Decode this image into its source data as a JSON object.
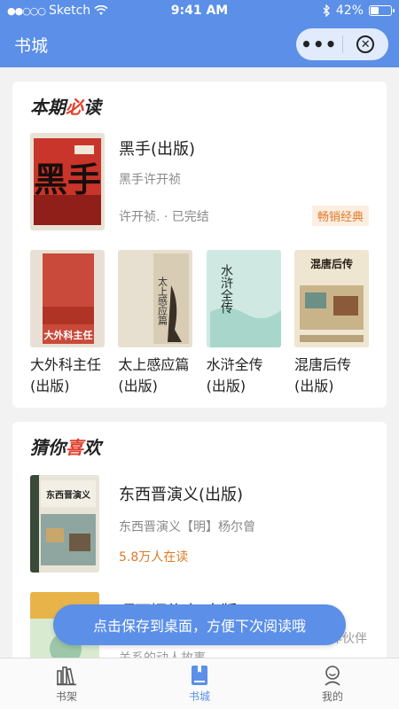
{
  "status_bar": {
    "carrier": "Sketch",
    "time": "9:41 AM",
    "battery_percent": "42%",
    "battery_level": 0.42,
    "signal_dots": "●●○○○"
  },
  "navbar": {
    "title": "书城",
    "more_label": "•••"
  },
  "must_read": {
    "title_before": "本期",
    "title_accent": "必",
    "title_after": "读",
    "featured": {
      "title": "黑手(出版)",
      "subtitle": "黑手许开祯",
      "author_status": "许开祯. · 已完结",
      "tag": "畅销经典",
      "cover_text": "黑手"
    },
    "books": [
      {
        "title_line1": "大外科主任",
        "title_line2": "(出版)",
        "cover_text": "大外科主任"
      },
      {
        "title_line1": "太上感应篇",
        "title_line2": "(出版)",
        "cover_text": "太上感应篇"
      },
      {
        "title_line1": "水浒全传",
        "title_line2": "(出版)",
        "cover_text": "水浒全传"
      },
      {
        "title_line1": "混唐后传",
        "title_line2": "(出版)",
        "cover_text": "混唐后传"
      }
    ]
  },
  "guess_like": {
    "title_before": "猜你",
    "title_accent": "喜",
    "title_after": "欢",
    "items": [
      {
        "title": "东西晋演义(出版)",
        "subtitle": "东西晋演义【明】杨尔曾",
        "readers": "5.8万人在读",
        "cover_text": "东西晋演义"
      },
      {
        "title": "嘎丽娅传奇(出版)",
        "description": "本书讲述了一位……俄两国人民战略协作伙伴关系的动人故事。"
      }
    ]
  },
  "toast": "点击保存到桌面，方便下次阅读哦",
  "tabbar": {
    "tabs": [
      {
        "label": "书架",
        "icon": "bookshelf-icon"
      },
      {
        "label": "书城",
        "icon": "book-icon"
      },
      {
        "label": "我的",
        "icon": "user-icon"
      }
    ],
    "active": "书城"
  },
  "colors": {
    "primary": "#5b8fe8",
    "accent_red": "#e0402f",
    "orange": "#e07a28"
  }
}
